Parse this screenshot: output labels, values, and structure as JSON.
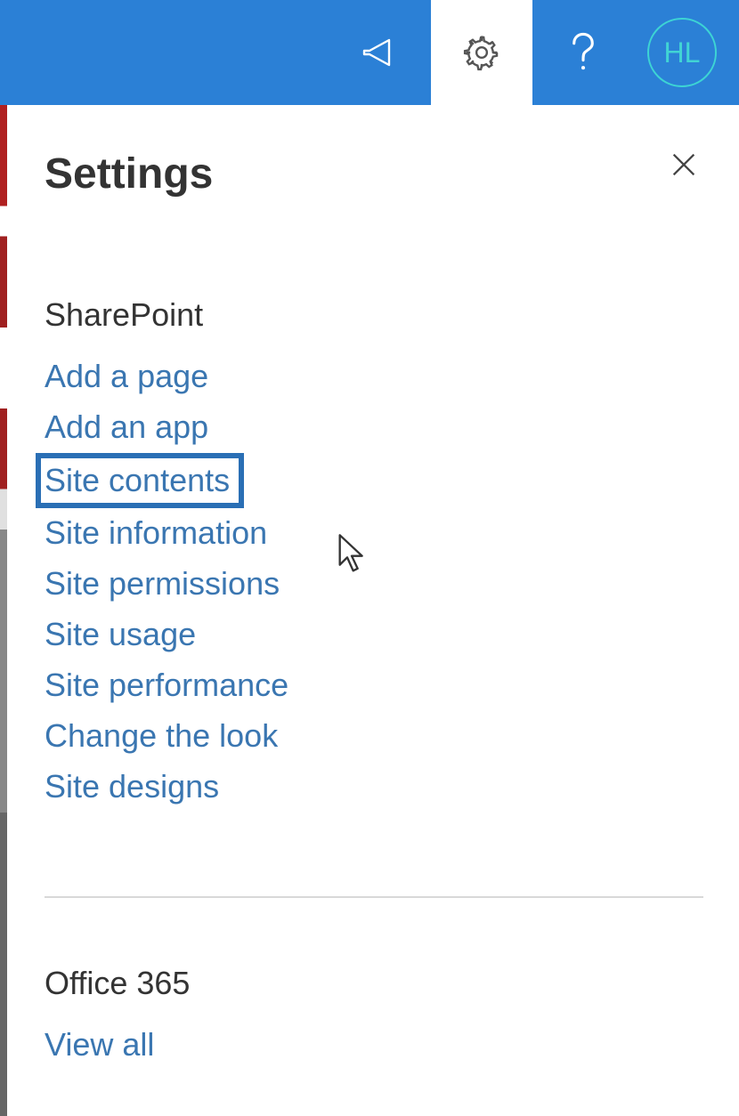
{
  "header": {
    "avatar_initials": "HL"
  },
  "panel": {
    "title": "Settings",
    "sections": [
      {
        "title": "SharePoint",
        "links": [
          "Add a page",
          "Add an app",
          "Site contents",
          "Site information",
          "Site permissions",
          "Site usage",
          "Site performance",
          "Change the look",
          "Site designs"
        ],
        "highlighted_index": 2
      },
      {
        "title": "Office 365",
        "links": [
          "View all"
        ]
      }
    ]
  }
}
